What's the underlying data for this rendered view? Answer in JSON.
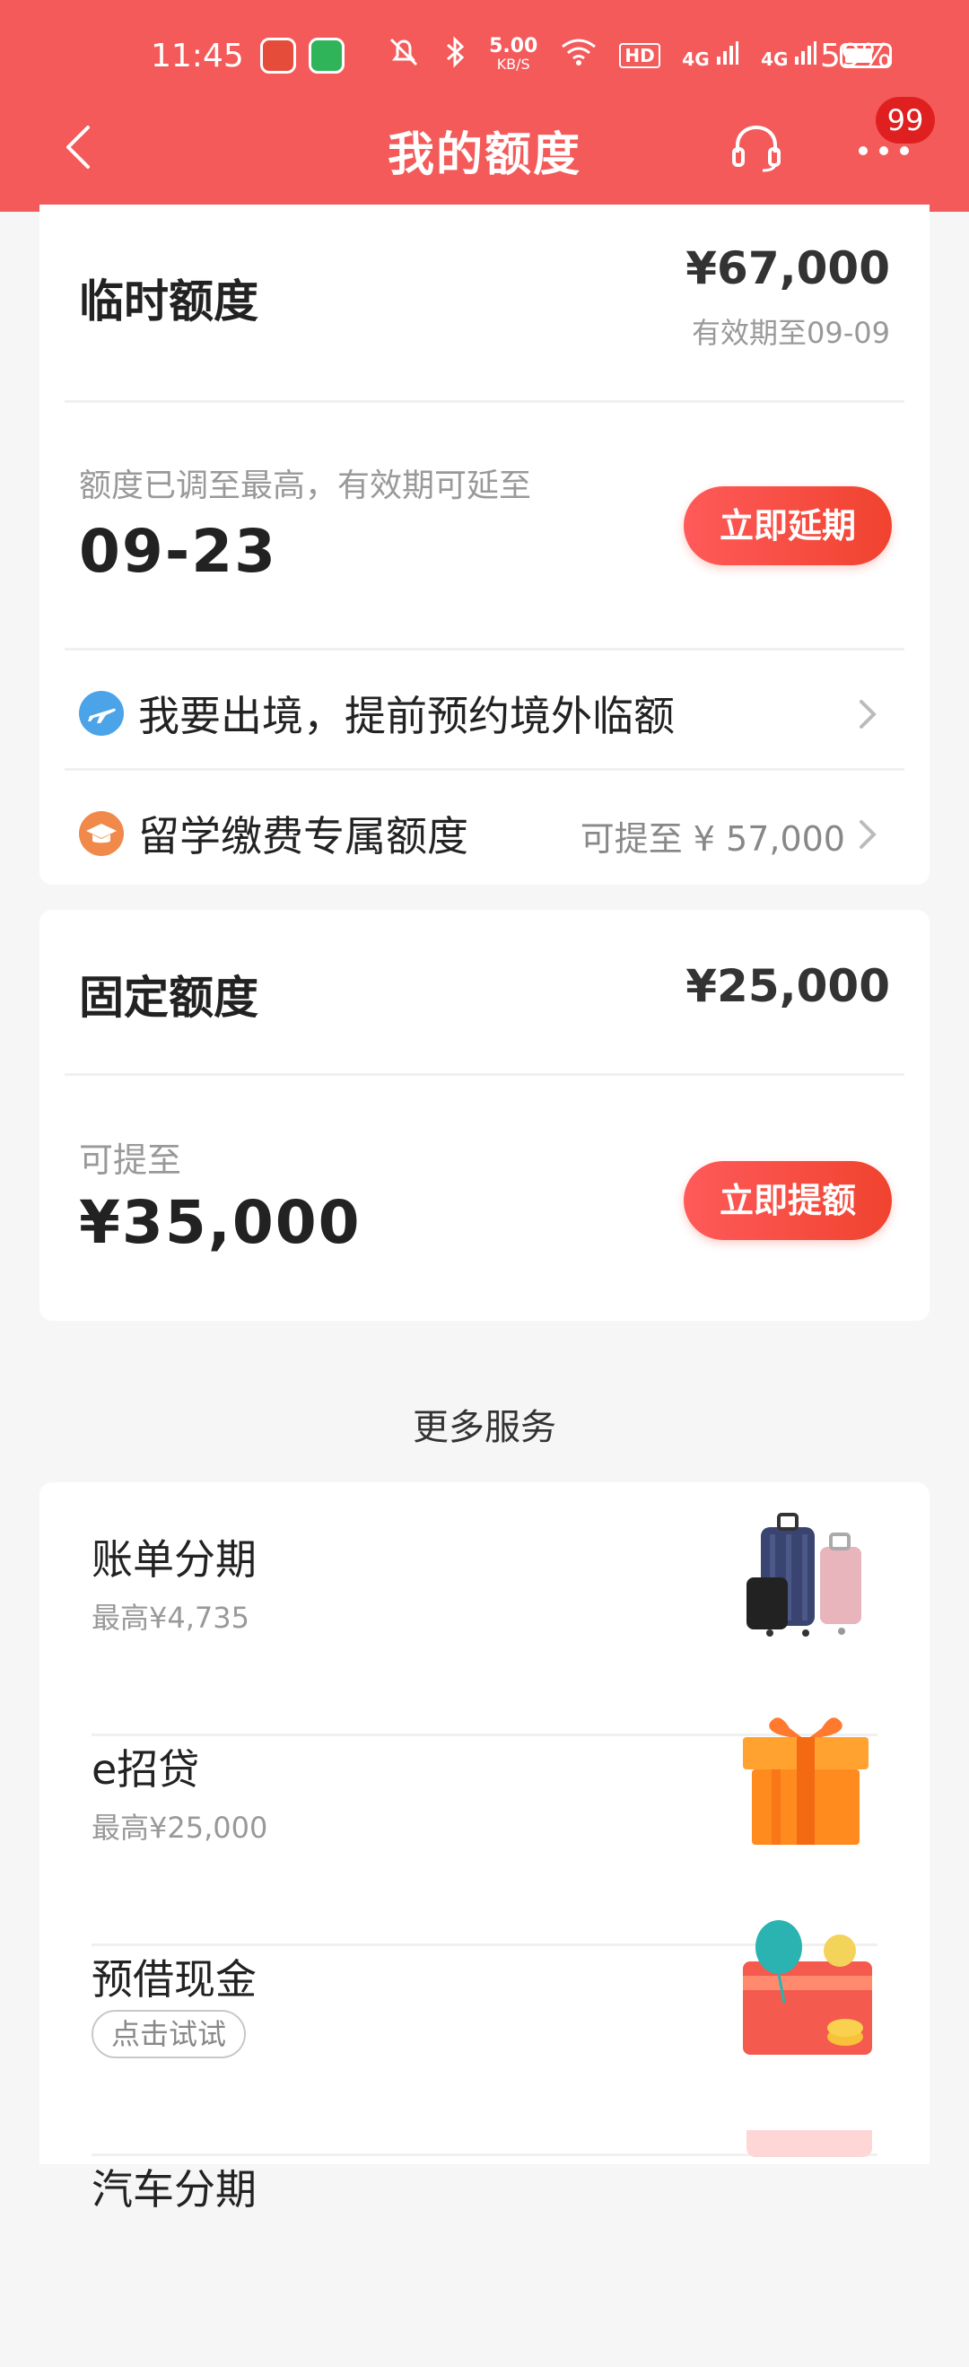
{
  "status": {
    "time": "11:45",
    "net_speed": "5.00",
    "net_unit": "KB/S",
    "hd": "HD",
    "sig1": "4G",
    "sig2": "4G",
    "battery": "59%"
  },
  "header": {
    "title": "我的额度",
    "badge": "99",
    "bg_color": "#f45a5a"
  },
  "temp_credit": {
    "title": "临时额度",
    "amount": "¥67,000",
    "valid_until": "有效期至09-09",
    "note": "额度已调至最高，有效期可延至",
    "extend_date": "09-23",
    "extend_button": "立即延期",
    "links": [
      {
        "label": "我要出境，提前预约境外临额",
        "right": "",
        "icon": "airplane-icon"
      },
      {
        "label": "留学缴费专属额度",
        "right": "可提至 ¥ 57,000",
        "icon": "graduation-cap-icon"
      }
    ]
  },
  "fixed_credit": {
    "title": "固定额度",
    "amount": "¥25,000",
    "can_raise_label": "可提至",
    "can_raise_amount": "¥35,000",
    "raise_button": "立即提额"
  },
  "more_services": {
    "title": "更多服务",
    "items": [
      {
        "title": "账单分期",
        "sub": "最高¥4,735",
        "tag": "",
        "image": "luggage-illustration"
      },
      {
        "title": "e招贷",
        "sub": "最高¥25,000",
        "tag": "",
        "image": "gift-box-illustration"
      },
      {
        "title": "预借现金",
        "sub": "",
        "tag": "点击试试",
        "image": "card-balloon-illustration"
      },
      {
        "title": "汽车分期",
        "sub": "",
        "tag": "",
        "image": "partial-illustration"
      }
    ]
  }
}
